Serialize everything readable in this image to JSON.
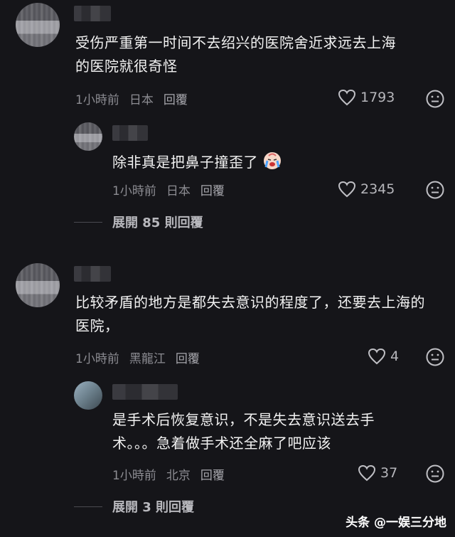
{
  "comments": [
    {
      "text": "受伤严重第一时间不去绍兴的医院舍近求远去上海的医院就很奇怪",
      "time": "1小時前",
      "location": "日本",
      "reply_label": "回覆",
      "likes": "1793"
    },
    {
      "text": "除非真是把鼻子撞歪了",
      "time": "1小時前",
      "location": "日本",
      "reply_label": "回覆",
      "likes": "2345"
    },
    {
      "text": "比较矛盾的地方是都失去意识的程度了，还要去上海的医院，",
      "time": "1小時前",
      "location": "黑龍江",
      "reply_label": "回覆",
      "likes": "4"
    },
    {
      "text": "是手术后恢复意识，不是失去意识送去手术。。。急着做手术还全麻了吧应该",
      "time": "1小時前",
      "location": "北京",
      "reply_label": "回覆",
      "likes": "37"
    }
  ],
  "expand_1": "展開 85 則回覆",
  "expand_2": "展開 3 則回覆",
  "watermark": "头条 @一娱三分地",
  "colors": {
    "background": "#151519",
    "text": "#f2f2f2",
    "meta": "#8c8c92"
  },
  "icons": [
    "heart-icon",
    "reaction-face-icon",
    "crying-face-emoji"
  ]
}
